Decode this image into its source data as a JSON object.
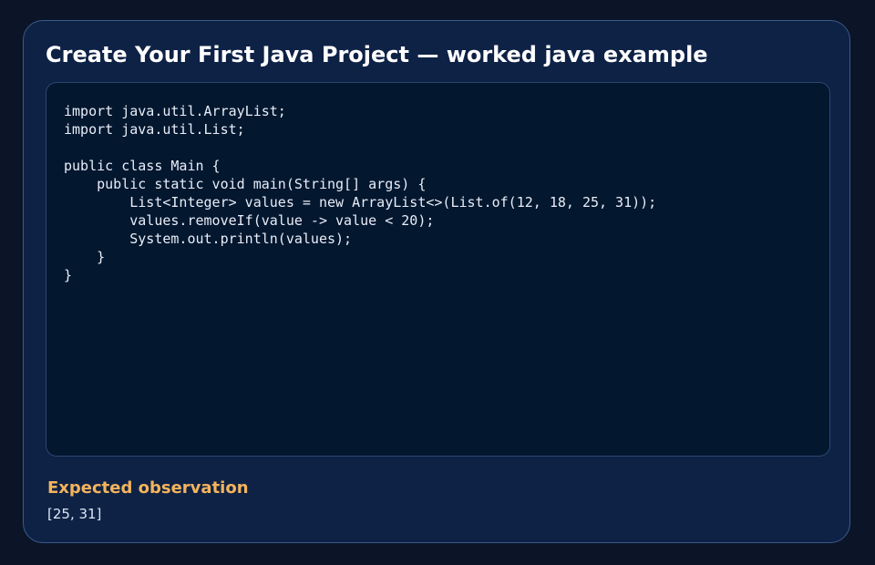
{
  "card": {
    "title": "Create Your First Java Project — worked java example"
  },
  "code_panel": {
    "language": "java",
    "code": "import java.util.ArrayList;\nimport java.util.List;\n\npublic class Main {\n    public static void main(String[] args) {\n        List<Integer> values = new ArrayList<>(List.of(12, 18, 25, 31));\n        values.removeIf(value -> value < 20);\n        System.out.println(values);\n    }\n}"
  },
  "observation": {
    "heading": "Expected observation",
    "value": "[25, 31]"
  },
  "colors": {
    "page_background": "#0b1527",
    "card_background": "#0e2246",
    "card_border": "#3b5a8a",
    "code_background": "#03172f",
    "title_text": "#ffffff",
    "code_text": "#e8eef8",
    "observation_heading": "#f4b45c"
  }
}
